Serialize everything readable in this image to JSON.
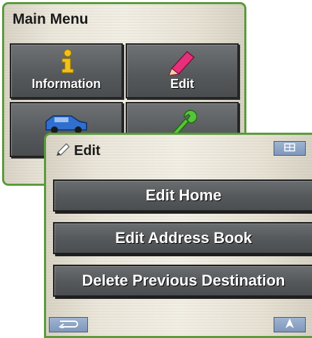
{
  "main_menu": {
    "title": "Main Menu",
    "tiles": [
      {
        "label": "Information",
        "icon": "info-icon"
      },
      {
        "label": "Edit",
        "icon": "pencil-icon"
      },
      {
        "label": "",
        "icon": "car-icon"
      },
      {
        "label": "",
        "icon": "wrench-icon"
      }
    ]
  },
  "edit_dialog": {
    "title": "Edit",
    "title_icon": "pencil-icon",
    "corner_icon": "keyboard-icon",
    "buttons": [
      {
        "label": "Edit Home"
      },
      {
        "label": "Edit Address Book"
      },
      {
        "label": "Delete Previous Destination"
      }
    ],
    "back_icon": "back-arrow-icon",
    "nav_icon": "navigation-arrow-icon"
  },
  "colors": {
    "frame_green": "#5a9a3a",
    "info_yellow": "#f2c21a",
    "edit_pink": "#e8307a",
    "car_blue": "#2f6fd0",
    "wrench_green": "#56c43b"
  }
}
